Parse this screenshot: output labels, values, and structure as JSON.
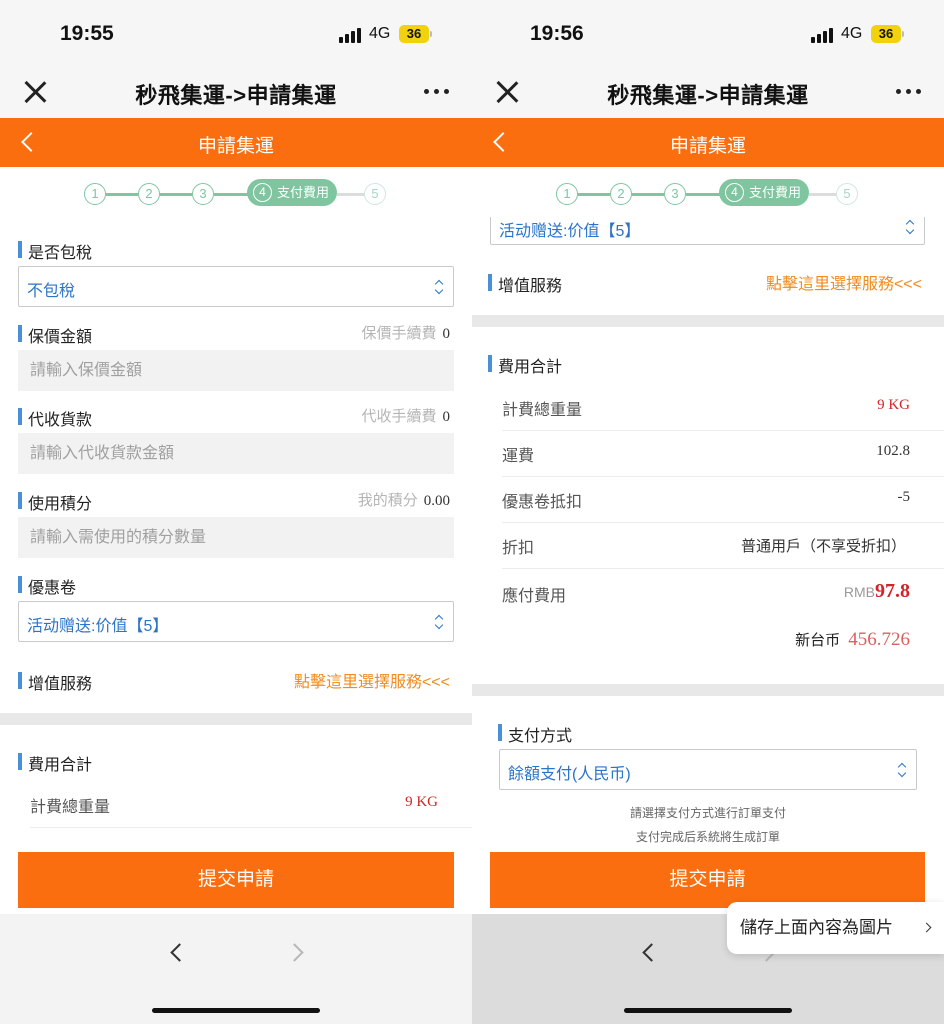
{
  "status": {
    "left_time": "19:55",
    "right_time": "19:56",
    "network": "4G",
    "battery": "36"
  },
  "app": {
    "title": "秒飛集運->申請集運"
  },
  "nav": {
    "title": "申請集運"
  },
  "steps": {
    "items": [
      "1",
      "2",
      "3",
      "4",
      "5"
    ],
    "active_label": "支付費用"
  },
  "form": {
    "tax": {
      "label": "是否包稅",
      "value": "不包稅"
    },
    "insurance": {
      "label": "保價金額",
      "note": "保價手續費",
      "fee": "0",
      "placeholder": "請輸入保價金額"
    },
    "cod": {
      "label": "代收貨款",
      "note": "代收手續費",
      "fee": "0",
      "placeholder": "請輸入代收貨款金額"
    },
    "points": {
      "label": "使用積分",
      "note": "我的積分",
      "balance": "0.00",
      "placeholder": "請輸入需使用的積分數量"
    },
    "coupon": {
      "label": "優惠卷",
      "value": "活动赠送:价值【5】"
    },
    "value_added": {
      "label": "增值服務",
      "link": "點擊這里選擇服務<<<"
    }
  },
  "fees": {
    "label": "費用合計",
    "weight": {
      "label": "計費總重量",
      "value": "9 KG"
    },
    "freight": {
      "label": "運費",
      "value": "102.8"
    },
    "coupon_deduct": {
      "label": "優惠卷抵扣",
      "value": "-5"
    },
    "discount": {
      "label": "折扣",
      "value": "普通用戶（不享受折扣）"
    },
    "payable": {
      "label": "應付費用",
      "currency": "RMB",
      "amount": "97.8"
    },
    "twd": {
      "label": "新台币",
      "amount": "456.726"
    }
  },
  "payment": {
    "label": "支付方式",
    "value": "餘額支付(人民币)",
    "note1": "請選擇支付方式進行訂單支付",
    "note2": "支付完成后系統將生成訂單"
  },
  "submit_label": "提交申請",
  "save_image_label": "儲存上面內容為圖片"
}
